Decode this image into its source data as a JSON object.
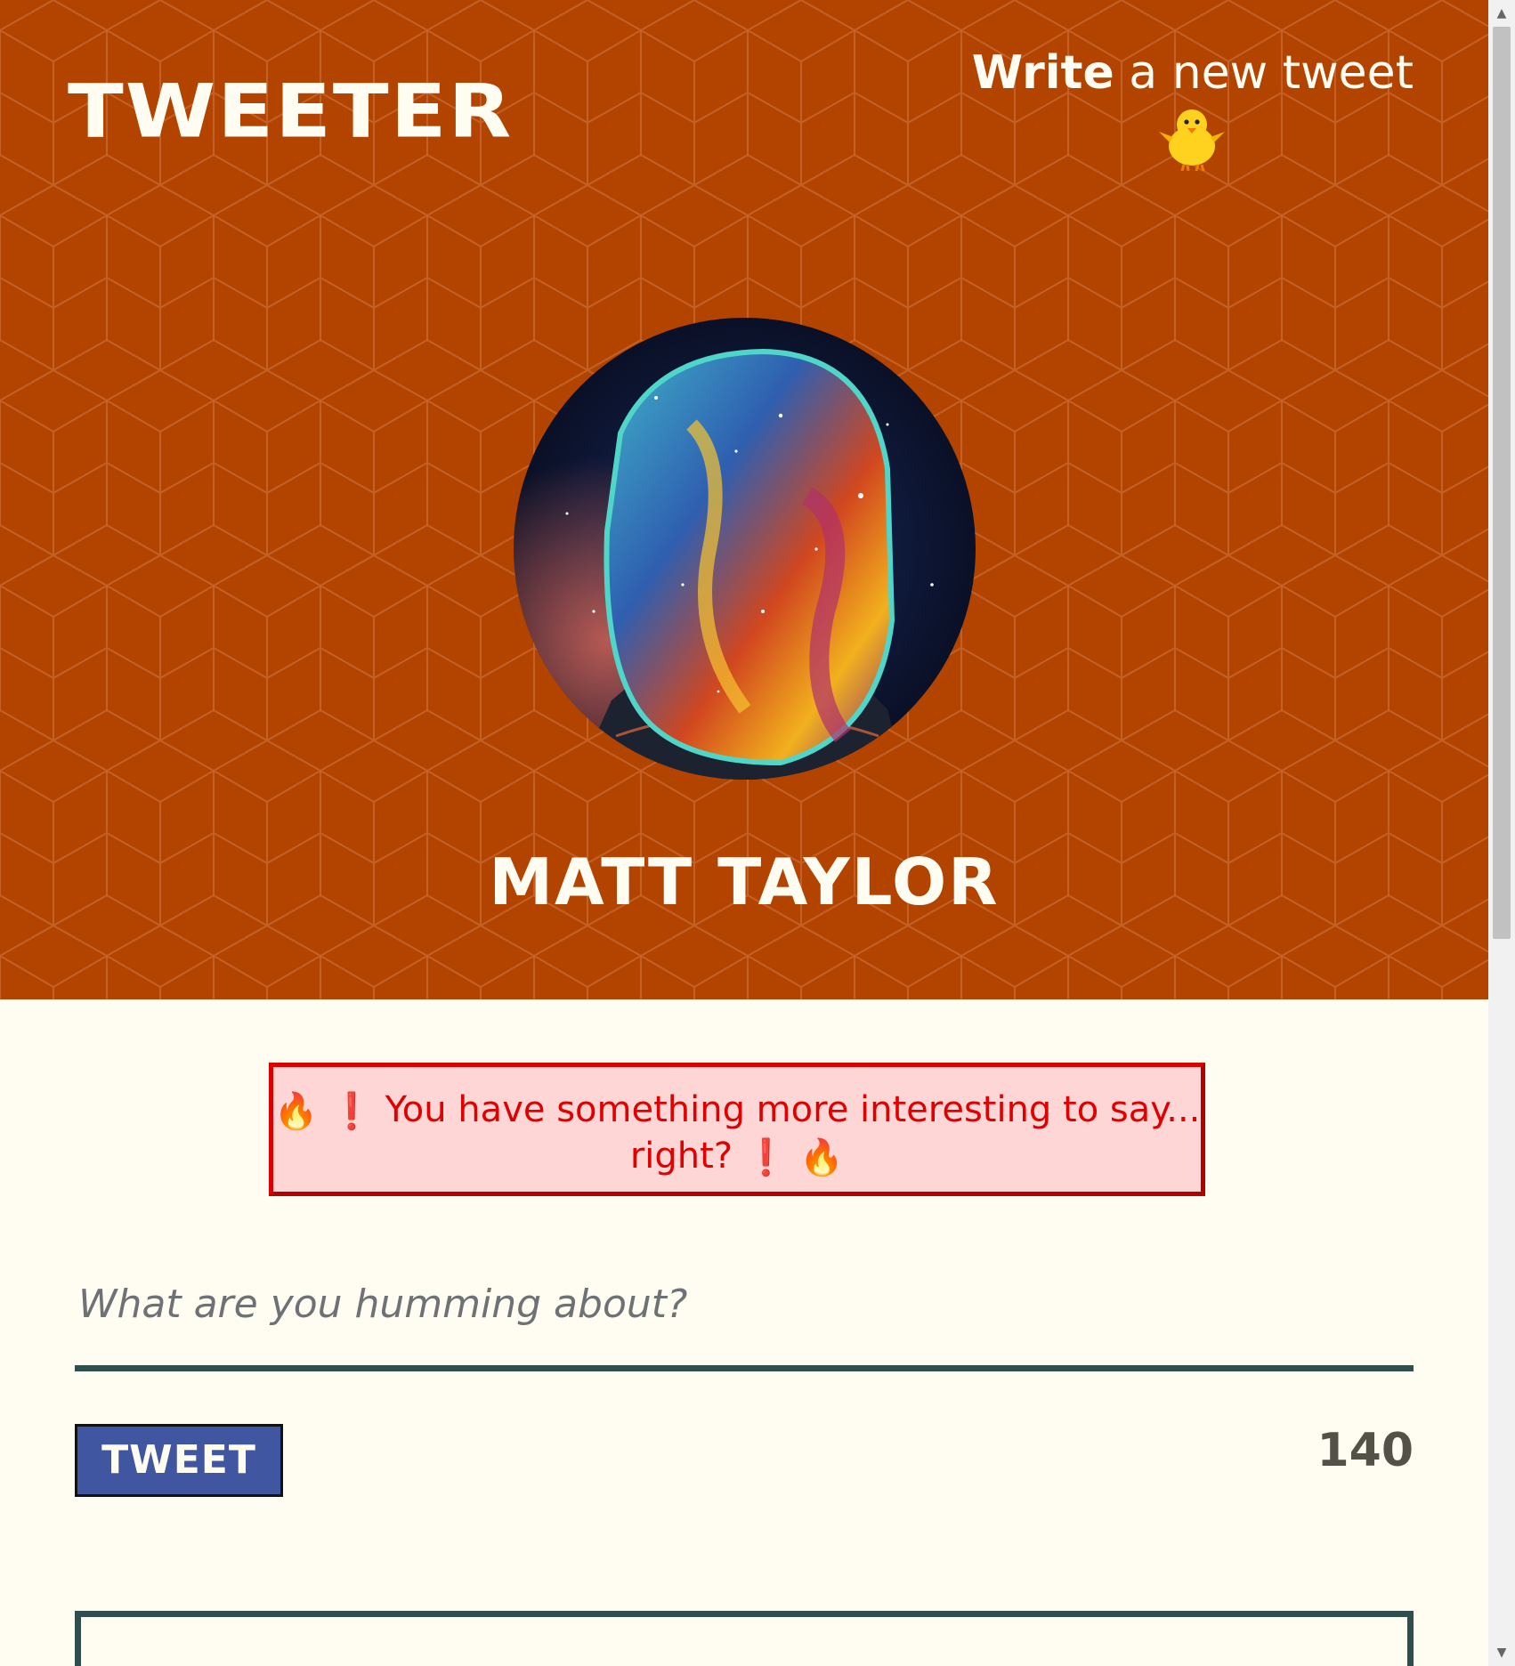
{
  "header": {
    "brand": "TWEETER",
    "compose_bold": "Write",
    "compose_rest": " a new tweet",
    "compose_icon": "chick-icon",
    "username": "MATT TAYLOR",
    "avatar_icon": "space-helmet-avatar",
    "background_color": "#b34400"
  },
  "error": {
    "icon_left": "🔥 ❗",
    "message": "You have something more interesting to say... right?",
    "icon_right": "❗ 🔥"
  },
  "composer": {
    "placeholder": "What are you humming about?",
    "value": "",
    "button_label": "TWEET",
    "counter": "140"
  },
  "colors": {
    "accent_button": "#4056a1",
    "error_text": "#e00000",
    "error_bg": "#ffd6d6",
    "rule": "#2f4f4f",
    "page_bg": "#fffdf2"
  }
}
